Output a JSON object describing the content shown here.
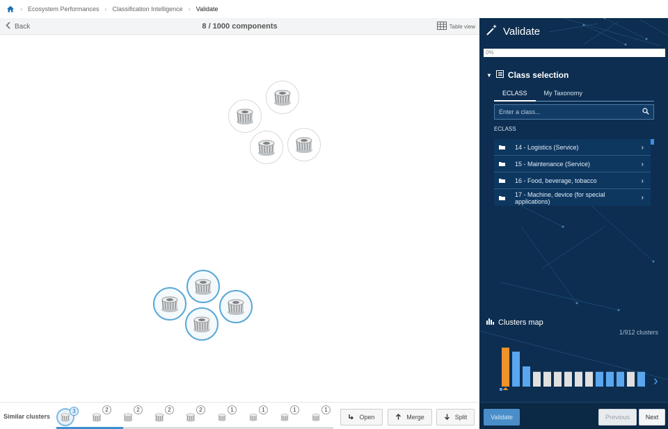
{
  "breadcrumb": {
    "home_icon": "home-icon",
    "items": [
      "Ecosystem Performances",
      "Classification Intelligence",
      "Validate"
    ]
  },
  "toolbar": {
    "back_label": "Back",
    "count_label": "8 / 1000 components",
    "table_view_label": "Table view"
  },
  "similar": {
    "label": "Similar clusters",
    "badges": [
      "3",
      "2",
      "2",
      "2",
      "2",
      "1",
      "1",
      "1",
      "1"
    ],
    "scroll_progress": 0.24
  },
  "actions": {
    "open_label": "Open",
    "merge_label": "Merge",
    "split_label": "Split"
  },
  "panel": {
    "title": "Validate",
    "progress_text": "0%",
    "class_selection_title": "Class selection",
    "tabs": [
      "ECLASS",
      "My Taxonomy"
    ],
    "search_placeholder": "Enter a class...",
    "list_label": "ECLASS",
    "classes": [
      "14 - Logistics (Service)",
      "15 - Maintenance (Service)",
      "16 - Food, beverage, tobacco",
      "17 - Machine, device (for special applications)"
    ],
    "clusters_map_title": "Clusters map",
    "clusters_count": "1/912 clusters",
    "validate_label": "Validate",
    "previous_label": "Previous",
    "next_label": "Next"
  },
  "chart_data": {
    "type": "bar",
    "values": [
      58,
      52,
      30,
      22,
      22,
      22,
      22,
      22,
      22,
      22,
      22,
      22,
      22,
      22
    ],
    "colors": [
      "#f0932b",
      "#5aa7ef",
      "#5aa7ef",
      "#e0e0e0",
      "#e0e0e0",
      "#e0e0e0",
      "#e0e0e0",
      "#e0e0e0",
      "#e0e0e0",
      "#5aa7ef",
      "#5aa7ef",
      "#5aa7ef",
      "#e0e0e0",
      "#5aa7ef"
    ],
    "selected_index": 0,
    "ymax": 60
  },
  "colors": {
    "panel_bg": "#0d2e50",
    "accent": "#3b8fd0",
    "selected_bar": "#f0932b"
  }
}
